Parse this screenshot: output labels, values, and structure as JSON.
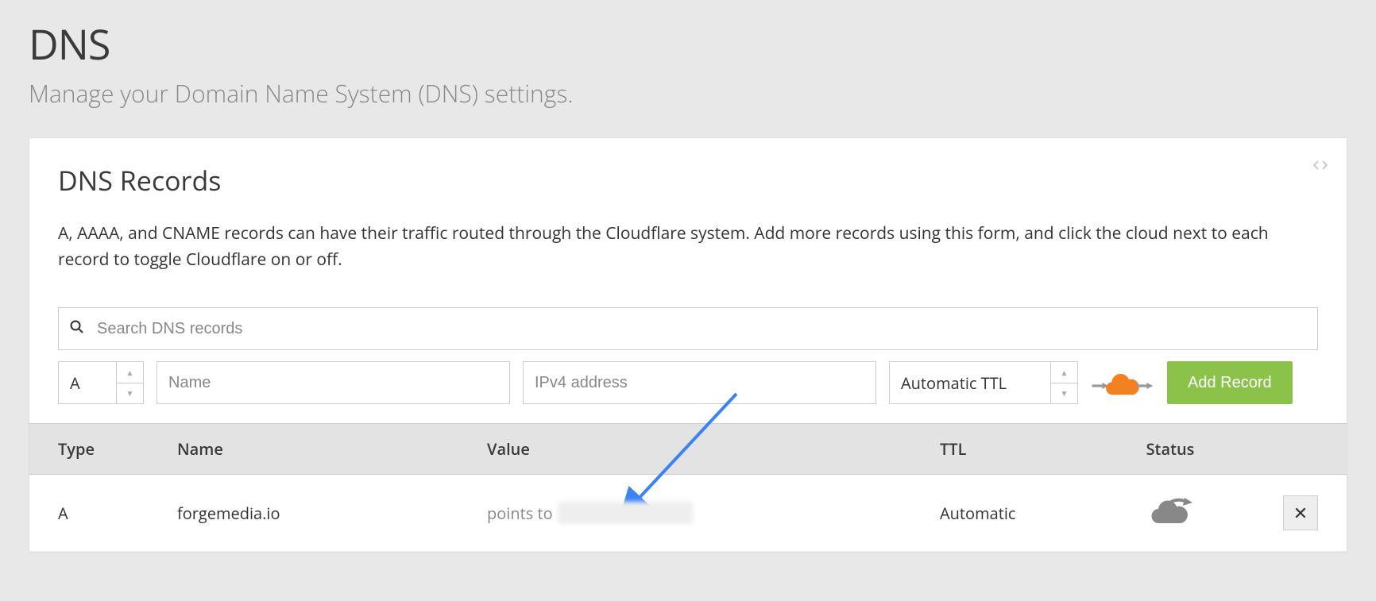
{
  "header": {
    "title": "DNS",
    "subtitle": "Manage your Domain Name System (DNS) settings."
  },
  "card": {
    "title": "DNS Records",
    "description": "A, AAAA, and CNAME records can have their traffic routed through the Cloudflare system. Add more records using this form, and click the cloud next to each record to toggle Cloudflare on or off."
  },
  "search": {
    "placeholder": "Search DNS records"
  },
  "form": {
    "type_value": "A",
    "name_placeholder": "Name",
    "value_placeholder": "IPv4 address",
    "ttl_value": "Automatic TTL",
    "add_label": "Add Record"
  },
  "table": {
    "headers": {
      "type": "Type",
      "name": "Name",
      "value": "Value",
      "ttl": "TTL",
      "status": "Status"
    },
    "rows": [
      {
        "type": "A",
        "name": "forgemedia.io",
        "value_prefix": "points to ",
        "ttl": "Automatic"
      }
    ]
  }
}
